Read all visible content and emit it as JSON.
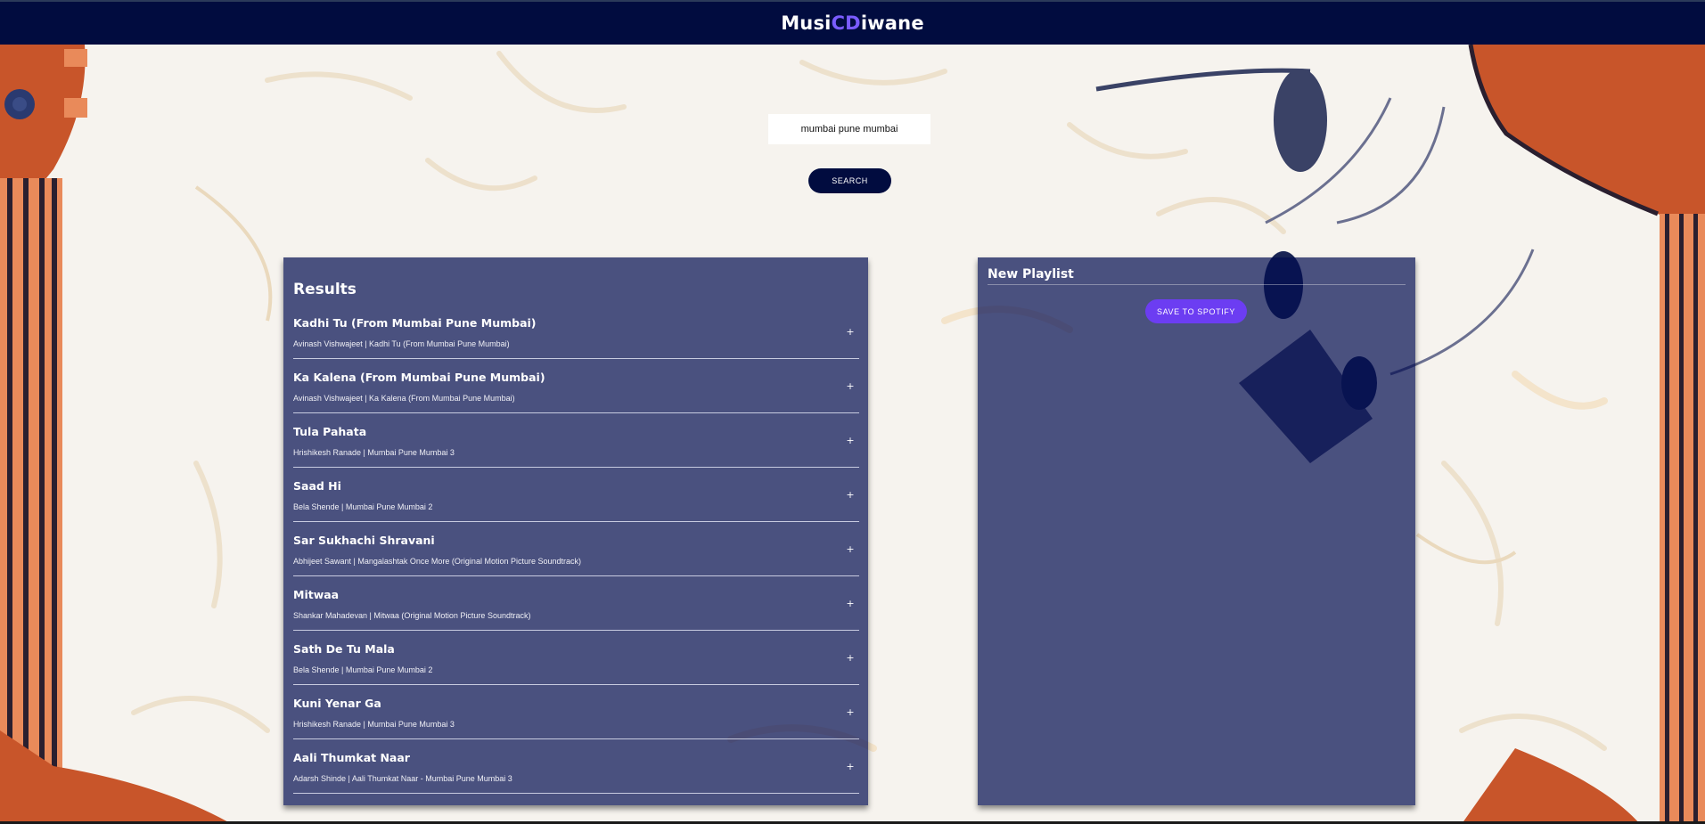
{
  "header": {
    "brand_part1": "Musi",
    "brand_accent": "CD",
    "brand_part2": "iwane"
  },
  "search": {
    "value": "mumbai pune mumbai",
    "button_label": "SEARCH"
  },
  "results": {
    "title": "Results",
    "add_symbol": "+",
    "tracks": [
      {
        "name": "Kadhi Tu (From Mumbai Pune Mumbai)",
        "info": "Avinash Vishwajeet | Kadhi Tu (From Mumbai Pune Mumbai)"
      },
      {
        "name": "Ka Kalena (From Mumbai Pune Mumbai)",
        "info": "Avinash Vishwajeet | Ka Kalena (From Mumbai Pune Mumbai)"
      },
      {
        "name": "Tula Pahata",
        "info": "Hrishikesh Ranade | Mumbai Pune Mumbai 3"
      },
      {
        "name": "Saad Hi",
        "info": "Bela Shende | Mumbai Pune Mumbai 2"
      },
      {
        "name": "Sar Sukhachi Shravani",
        "info": "Abhijeet Sawant | Mangalashtak Once More (Original Motion Picture Soundtrack)"
      },
      {
        "name": "Mitwaa",
        "info": "Shankar Mahadevan | Mitwaa (Original Motion Picture Soundtrack)"
      },
      {
        "name": "Sath De Tu Mala",
        "info": "Bela Shende | Mumbai Pune Mumbai 2"
      },
      {
        "name": "Kuni Yenar Ga",
        "info": "Hrishikesh Ranade | Mumbai Pune Mumbai 3"
      },
      {
        "name": "Aali Thumkat Naar",
        "info": "Adarsh Shinde | Aali Thumkat Naar - Mumbai Pune Mumbai 3"
      }
    ]
  },
  "playlist": {
    "name": "New Playlist",
    "save_label": "SAVE TO SPOTIFY"
  },
  "colors": {
    "navbar": "#010c3f",
    "accent": "#6c3df2",
    "panel": "#4a507a"
  }
}
